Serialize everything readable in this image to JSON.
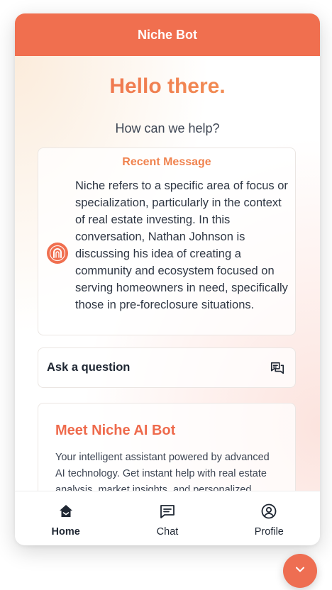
{
  "header": {
    "title": "Niche Bot"
  },
  "hero": {
    "greeting": "Hello there.",
    "subtitle": "How can we help?"
  },
  "recent_message": {
    "title": "Recent Message",
    "text": "Niche refers to a specific area of focus or specialization, particularly in the context of real estate investing. In this conversation, Nathan Johnson is discussing his idea of creating a community and ecosystem focused on serving homeowners in need, specifically those in pre-foreclosure situations.",
    "icon": "niche-logo-icon"
  },
  "ask": {
    "label": "Ask a question",
    "icon": "chat-bubbles-icon"
  },
  "meet": {
    "title": "Meet Niche AI Bot",
    "text": "Your intelligent assistant powered by advanced AI technology. Get instant help with real estate analysis, market insights, and personalized recommendations. Whether you're looking for"
  },
  "nav": {
    "items": [
      {
        "label": "Home",
        "icon": "home-icon",
        "active": true
      },
      {
        "label": "Chat",
        "icon": "chat-icon",
        "active": false
      },
      {
        "label": "Profile",
        "icon": "user-circle-icon",
        "active": false
      }
    ]
  },
  "fab": {
    "icon": "chevron-down-icon"
  },
  "colors": {
    "accent": "#f06f4f",
    "gradient_end": "#f39b57",
    "text": "#2f3744"
  }
}
